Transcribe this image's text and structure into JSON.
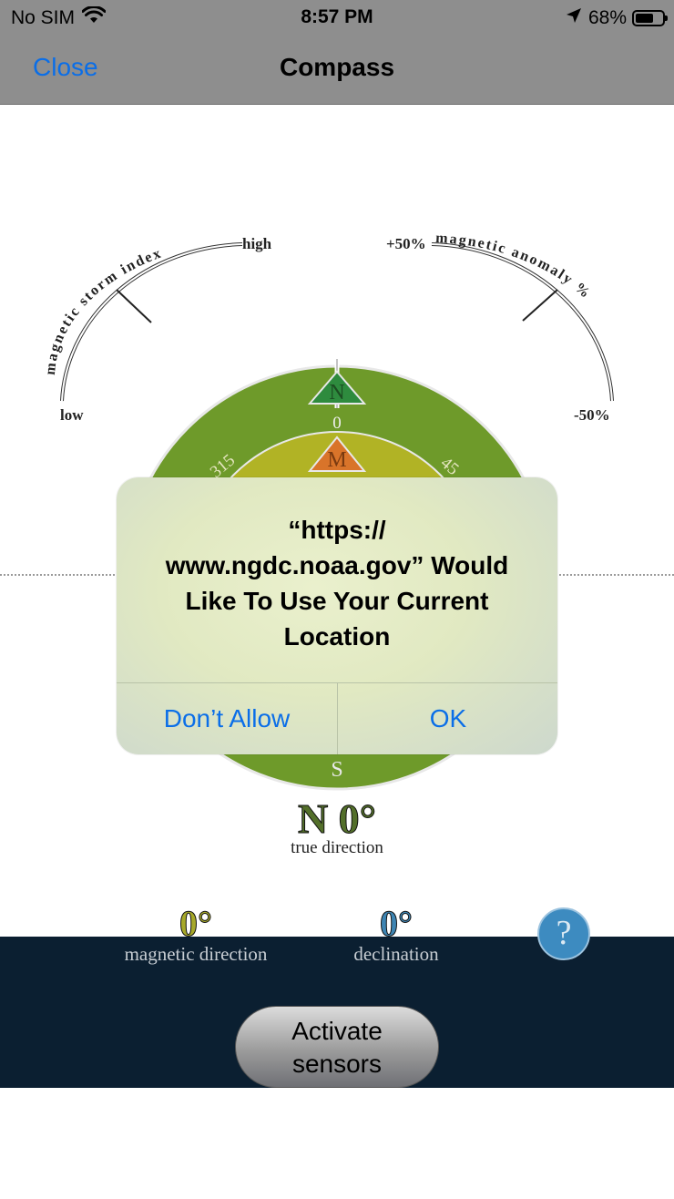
{
  "status_bar": {
    "carrier": "No SIM",
    "time": "8:57 PM",
    "battery_percent": "68%",
    "battery_level": 0.68,
    "icons": [
      "wifi-icon",
      "location-arrow-icon",
      "battery-icon"
    ]
  },
  "nav": {
    "close_label": "Close",
    "title": "Compass"
  },
  "storm_gauge": {
    "title": "magnetic storm index",
    "low_label": "low",
    "high_label": "high"
  },
  "anomaly_gauge": {
    "title": "magnetic anomaly %",
    "top_label": "+50%",
    "bottom_label": "-50%"
  },
  "compass": {
    "north_letter": "N",
    "magnetic_letter": "M",
    "south_letter": "S",
    "tick_0": "0",
    "tick_315": "315",
    "tick_45": "45",
    "outer_color": "#6e9a2a",
    "inner_color": "#b1b325",
    "north_marker_color": "#2e8b3e",
    "magnetic_marker_color": "#d9742a"
  },
  "true_direction": {
    "value": "N 0°",
    "label": "true direction"
  },
  "magnetic_direction": {
    "value": "0°",
    "label": "magnetic direction",
    "color": "#a7a92a"
  },
  "declination": {
    "value": "0°",
    "label": "declination",
    "color": "#3e85b3"
  },
  "help": {
    "label": "?"
  },
  "activate": {
    "line1": "Activate",
    "line2": "sensors"
  },
  "alert": {
    "title_lines": [
      "“https://",
      "www.ngdc.noaa.gov” Would",
      "Like To Use Your Current",
      "Location"
    ],
    "dont_allow_label": "Don’t Allow",
    "ok_label": "OK"
  }
}
